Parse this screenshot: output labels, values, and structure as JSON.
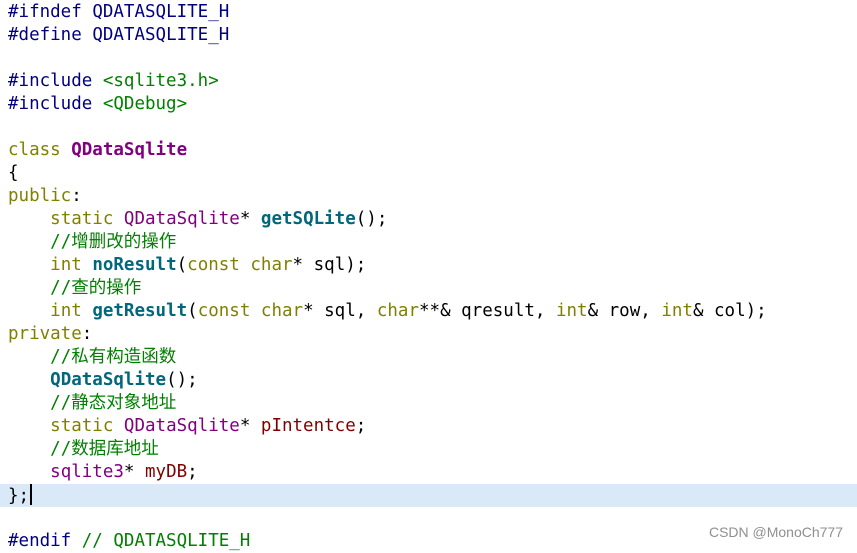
{
  "code": {
    "l1": {
      "directive": "#ifndef",
      "name": "QDATASQLITE_H"
    },
    "l2": {
      "directive": "#define",
      "name": "QDATASQLITE_H"
    },
    "l4": {
      "directive": "#include",
      "header": "<sqlite3.h>"
    },
    "l5": {
      "directive": "#include",
      "header": "<QDebug>"
    },
    "l7": {
      "keyword": "class",
      "classname": "QDataSqlite"
    },
    "l8": {
      "brace": "{"
    },
    "l9": {
      "access": "public",
      "colon": ":"
    },
    "l10": {
      "kw": "static",
      "type": "QDataSqlite",
      "ptr": "*",
      "func": "getSQLite",
      "rest": "();"
    },
    "l11": {
      "comment": "//增删改的操作"
    },
    "l12": {
      "kw": "int",
      "func": "noResult",
      "open": "(",
      "kw2": "const",
      "kw3": "char",
      "rest": "* sql);"
    },
    "l13": {
      "comment": "//查的操作"
    },
    "l14": {
      "kw": "int",
      "func": "getResult",
      "open": "(",
      "kw2": "const",
      "kw3": "char",
      "p1": "* sql, ",
      "kw4": "char",
      "p2": "**& qresult, ",
      "kw5": "int",
      "p3": "& row, ",
      "kw6": "int",
      "p4": "& col);"
    },
    "l15": {
      "access": "private",
      "colon": ":"
    },
    "l16": {
      "comment": "//私有构造函数"
    },
    "l17": {
      "func": "QDataSqlite",
      "rest": "();"
    },
    "l18": {
      "comment": "//静态对象地址"
    },
    "l19": {
      "kw": "static",
      "type": "QDataSqlite",
      "ptr": "* ",
      "member": "pIntentce",
      "rest": ";"
    },
    "l20": {
      "comment": "//数据库地址"
    },
    "l21": {
      "type": "sqlite3",
      "ptr": "* ",
      "member": "myDB",
      "rest": ";"
    },
    "l22": {
      "text": "};"
    },
    "l24": {
      "directive": "#endif",
      "comment": "// QDATASQLITE_H"
    }
  },
  "watermark": "CSDN @MonoCh777"
}
